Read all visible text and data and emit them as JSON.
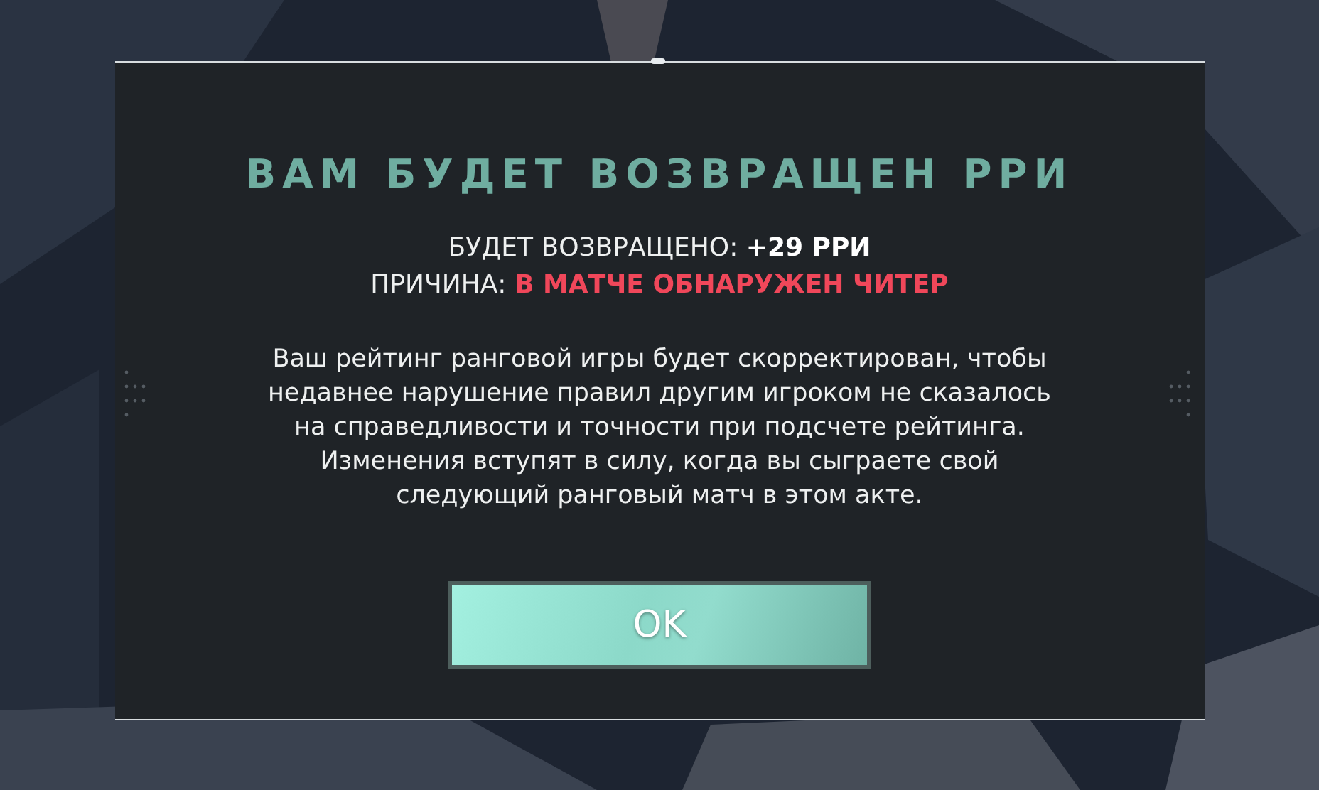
{
  "dialog": {
    "title": "ВАМ БУДЕТ ВОЗВРАЩЕН РРИ",
    "details": [
      {
        "label": "БУДЕТ ВОЗВРАЩЕНО:",
        "value": "+29 РРИ",
        "color": "#ffffff"
      },
      {
        "label": "ПРИЧИНА:",
        "value": "В МАТЧЕ ОБНАРУЖЕН ЧИТЕР",
        "color": "#f0475a"
      }
    ],
    "message_lines": [
      "Ваш рейтинг ранговой игры будет скорректирован, чтобы",
      "недавнее нарушение правил другим игроком не сказалось",
      "на справедливости и точности при подсчете рейтинга.",
      "Изменения вступят в силу, когда вы сыграете свой",
      "следующий ранговый матч в этом акте."
    ],
    "button": "OK"
  }
}
